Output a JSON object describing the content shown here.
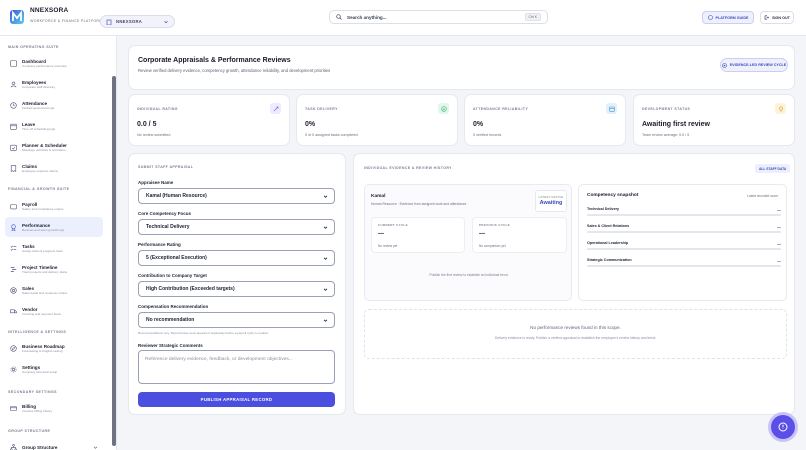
{
  "app": {
    "brand": "NNEXSORA",
    "brand_sub": "WORKFORCE & FINANCE PLATFORM",
    "workspace": "NNEXSORA"
  },
  "search": {
    "placeholder": "Search anything...",
    "shortcut": "Ctrl K"
  },
  "topbar": {
    "guide_label": "PLATFORM GUIDE",
    "signout_label": "SIGN OUT"
  },
  "sidebar": {
    "sections": [
      "MAIN OPERATING SUITE",
      "FINANCIAL & GROWTH SUITE",
      "INTELLIGENCE & SETTINGS",
      "SECONDARY SETTINGS",
      "GROUP STRUCTURE"
    ],
    "items": [
      {
        "label": "Dashboard",
        "sub": "Company performance overview"
      },
      {
        "label": "Employees",
        "sub": "Corporate staff directory"
      },
      {
        "label": "Attendance",
        "sub": "Verified geofenced logs"
      },
      {
        "label": "Leave",
        "sub": "Time off scheduling logs"
      },
      {
        "label": "Planner & Scheduler",
        "sub": "Meetings, activities & reminders"
      },
      {
        "label": "Claims",
        "sub": "Employee expense claims"
      },
      {
        "label": "Payroll",
        "sub": "Salary and compliance engine"
      },
      {
        "label": "Performance",
        "sub": "Reviews and team growth logs"
      },
      {
        "label": "Tasks",
        "sub": "Assign tasks & progress track"
      },
      {
        "label": "Project Timeline",
        "sub": "Track projects and delivery plans"
      },
      {
        "label": "Sales",
        "sub": "Sales leads and customer orders"
      },
      {
        "label": "Vendor",
        "sub": "Invoicing and payment flows"
      },
      {
        "label": "Business Roadmap",
        "sub": "Forecasting & insights setting"
      },
      {
        "label": "Settings",
        "sub": "Company structural setup"
      },
      {
        "label": "Billing",
        "sub": "Invoices billing history"
      },
      {
        "label": "Group Structure",
        "sub": ""
      }
    ]
  },
  "header": {
    "title": "Corporate Appraisals & Performance Reviews",
    "subtitle": "Review verified delivery evidence, competency growth, attendance reliability, and development priorities",
    "action": "EVIDENCE-LED REVIEW CYCLE"
  },
  "stats": [
    {
      "label": "INDIVIDUAL RATING",
      "value": "0.0 / 5",
      "sub": "No review submitted",
      "color": "#7b6cf0"
    },
    {
      "label": "TASK DELIVERY",
      "value": "0%",
      "sub": "0 of 0 assigned tasks completed",
      "color": "#2fb36b"
    },
    {
      "label": "ATTENDANCE RELIABILITY",
      "value": "0%",
      "sub": "0 verified records",
      "color": "#3b8fd9"
    },
    {
      "label": "DEVELOPMENT STATUS",
      "value": "Awaiting first review",
      "sub": "Team review average: 0.0 / 5",
      "color": "#e9a21a"
    }
  ],
  "form": {
    "caption": "SUBMIT STAFF APPRAISAL",
    "appraisee_label": "Appraisee Name",
    "appraisee_value": "Kamal (Human Resource)",
    "focus_label": "Core Competency Focus",
    "focus_value": "Technical Delivery",
    "rating_label": "Performance Rating",
    "rating_value": "5 (Exceptional Execution)",
    "contribution_label": "Contribution to Company Target",
    "contribution_value": "High Contribution (Exceeded targets)",
    "compensation_label": "Compensation Recommendation",
    "compensation_value": "No recommendation",
    "compensation_note": "Recommendations only. Record future level appears if separately before a payroll cycle is created.",
    "comments_label": "Reviewer Strategic Comments",
    "comments_placeholder": "Reference delivery evidence, feedback, or development objectives...",
    "submit_label": "PUBLISH APPRAISAL RECORD"
  },
  "history": {
    "caption": "INDIVIDUAL EVIDENCE & REVIEW HISTORY",
    "filter": "ALL STAFF DATA",
    "person_name": "Kamal",
    "person_sub": "Human Resource · Evidence from assigned work and attendance",
    "latest_label": "LATEST RATING",
    "latest_value": "Awaiting",
    "current_label": "CURRENT CYCLE",
    "current_value": "—",
    "current_sub": "No review yet",
    "previous_label": "PREVIOUS CYCLE",
    "previous_value": "—",
    "previous_sub": "No comparison yet",
    "hint": "Publish the first review to establish an individual trend.",
    "snapshot_title": "Competency snapshot",
    "snapshot_link": "Latest recorded score",
    "competencies": [
      {
        "name": "Technical Delivery",
        "value": "—"
      },
      {
        "name": "Sales & Client Relations",
        "value": "—"
      },
      {
        "name": "Operational Leadership",
        "value": "—"
      },
      {
        "name": "Strategic Communication",
        "value": "—"
      }
    ],
    "empty_title": "No performance reviews found in this scope.",
    "empty_sub": "Delivery evidence is ready. Publish a verified appraisal to establish the employee's review history and trend."
  }
}
